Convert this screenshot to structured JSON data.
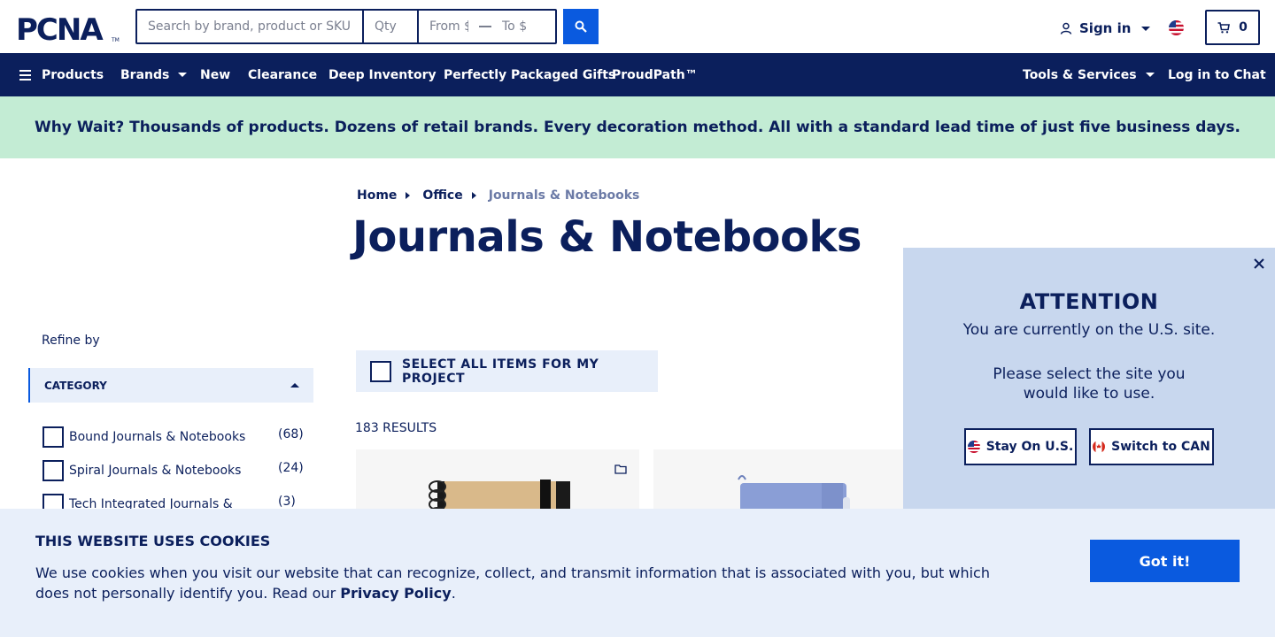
{
  "brand": {
    "logo_text": "PCNA",
    "tm": "TM"
  },
  "search": {
    "placeholder": "Search by brand, product or SKU",
    "qty_placeholder": "Qty",
    "price_from_placeholder": "From $",
    "price_to_placeholder": "To $",
    "button_icon": "search-icon"
  },
  "account": {
    "signin_label": "Sign in",
    "region_flag": "us-flag-icon",
    "cart_count": "0"
  },
  "nav": {
    "products": "Products",
    "brands": "Brands",
    "new": "New",
    "clearance": "Clearance",
    "deep_inventory": "Deep Inventory",
    "packaged_gifts": "Perfectly Packaged Gifts",
    "proudpath": "ProudPath™",
    "tools": "Tools & Services",
    "chat": "Log in to Chat"
  },
  "promo": {
    "text": "Why Wait? Thousands of products. Dozens of retail brands. Every decoration method. All with a standard lead time of just five business days."
  },
  "breadcrumb": {
    "home": "Home",
    "office": "Office",
    "current": "Journals & Notebooks"
  },
  "page": {
    "title": "Journals & Notebooks",
    "results": "183 RESULTS",
    "select_all": "SELECT ALL ITEMS FOR MY PROJECT"
  },
  "sidebar": {
    "refine_label": "Refine by",
    "category_heading": "CATEGORY",
    "categories": [
      {
        "label": "Bound Journals & Notebooks",
        "count": "(68)"
      },
      {
        "label": "Spiral Journals & Notebooks",
        "count": "(24)"
      },
      {
        "label": "Tech Integrated Journals &",
        "count": "(3)"
      }
    ]
  },
  "attention": {
    "title": "ATTENTION",
    "line1": "You are currently on the U.S. site.",
    "line2": "Please select the site you would like to use.",
    "stay_label": "Stay On U.S.",
    "switch_label": "Switch to CAN"
  },
  "cookie": {
    "title": "THIS WEBSITE USES COOKIES",
    "text": "We use cookies when you visit our website that can recognize, collect, and transmit information that is associated with you, but which does not personally identify you. Read our ",
    "link": "Privacy Policy",
    "end": ".",
    "button": "Got it!"
  },
  "colors": {
    "navy": "#0b1f5c",
    "accent_blue": "#0a5adf",
    "promo_green": "#c3ecd4",
    "panel_blue": "#c8d7ee",
    "light_blue": "#e8effa"
  }
}
